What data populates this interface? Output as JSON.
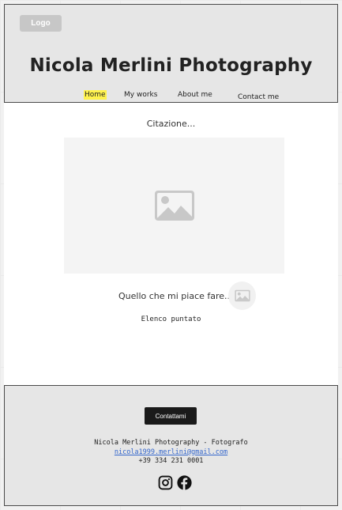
{
  "header": {
    "logo_label": "Logo",
    "site_title": "Nicola Merlini Photography",
    "nav": {
      "home": "Home",
      "works": "My works",
      "about": "About me",
      "contact": "Contact me"
    },
    "active_nav_highlight": "#fff24d"
  },
  "main": {
    "quote": "Citazione...",
    "hero_image_icon": "image-placeholder-icon",
    "likes_text": "Quello che mi piace fare...",
    "likes_image_icon": "image-placeholder-icon",
    "bullet_list": "Elenco puntato"
  },
  "footer": {
    "contact_button": "Contattami",
    "info_line": "Nicola Merlini Photography - Fotografo",
    "email": "nicola1999.merlini@gmail.com",
    "phone": "+39 334 231 0001",
    "social_icons": [
      "instagram-icon",
      "facebook-icon"
    ]
  },
  "colors": {
    "header_bg": "#e6e6e6",
    "button_bg": "#1a1a1a",
    "link": "#3366cc"
  }
}
